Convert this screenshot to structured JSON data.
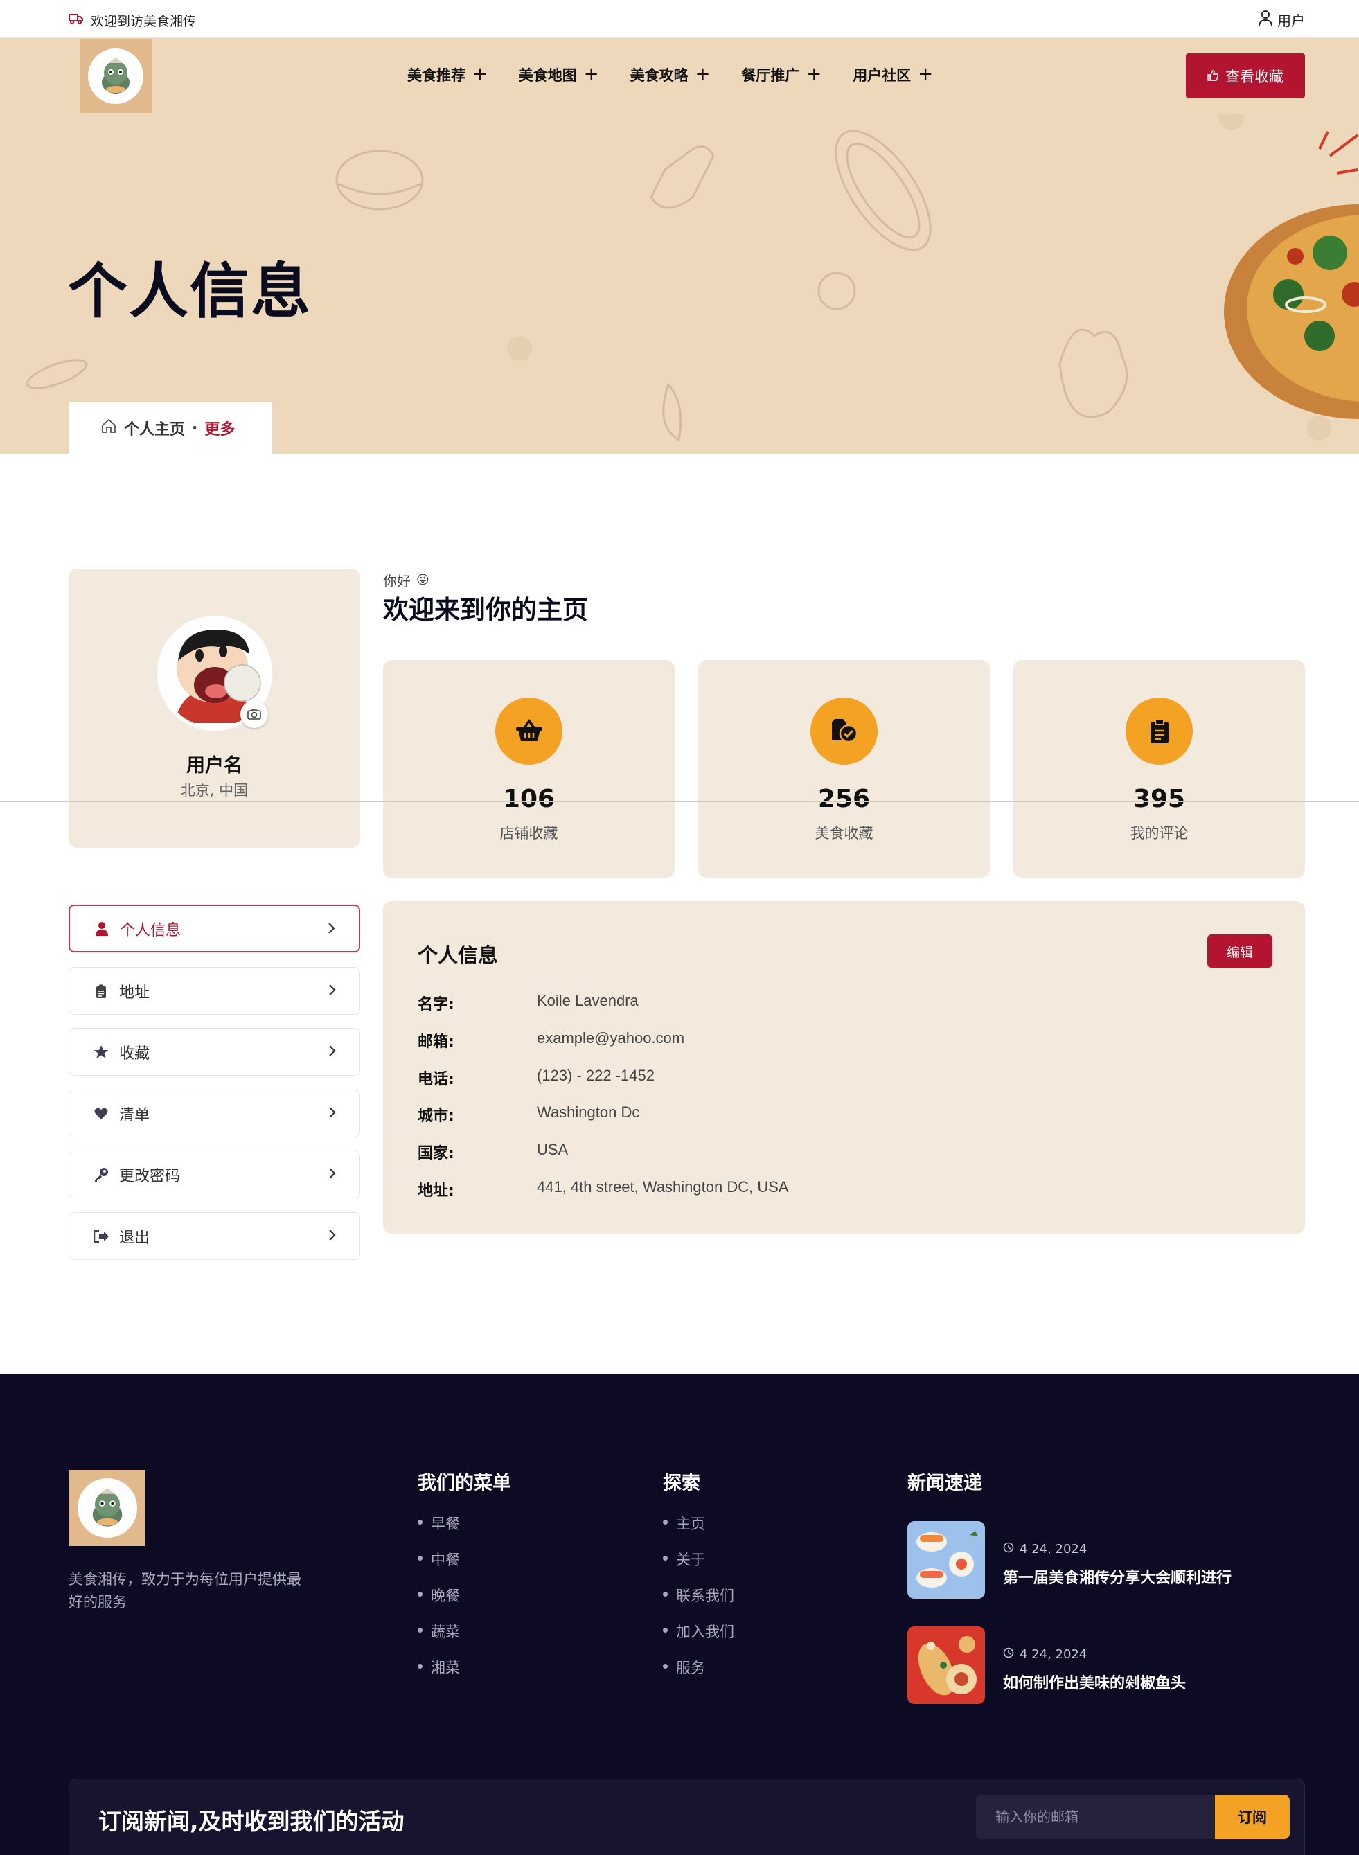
{
  "topbar": {
    "welcome": "欢迎到访美食湘传",
    "user_label": "用户"
  },
  "header": {
    "nav": [
      {
        "label": "美食推荐"
      },
      {
        "label": "美食地图"
      },
      {
        "label": "美食攻略"
      },
      {
        "label": "餐厅推广"
      },
      {
        "label": "用户社区"
      }
    ],
    "fav_button": "查看收藏"
  },
  "hero": {
    "title": "个人信息",
    "breadcrumb": {
      "home": "个人主页",
      "separator": "·",
      "current": "更多"
    }
  },
  "profile": {
    "name": "用户名",
    "location": "北京, 中国"
  },
  "greeting": {
    "small": "你好",
    "emoji": "😜",
    "title": "欢迎来到你的主页"
  },
  "stats": [
    {
      "value": "106",
      "label": "店铺收藏",
      "icon": "basket-icon"
    },
    {
      "value": "256",
      "label": "美食收藏",
      "icon": "box-check-icon"
    },
    {
      "value": "395",
      "label": "我的评论",
      "icon": "clipboard-icon"
    }
  ],
  "menu": [
    {
      "label": "个人信息",
      "icon": "user-icon",
      "active": true
    },
    {
      "label": "地址",
      "icon": "clipboard-icon"
    },
    {
      "label": "收藏",
      "icon": "star-icon"
    },
    {
      "label": "清单",
      "icon": "heart-icon"
    },
    {
      "label": "更改密码",
      "icon": "key-icon"
    },
    {
      "label": "退出",
      "icon": "logout-icon"
    }
  ],
  "info": {
    "title": "个人信息",
    "edit": "编辑",
    "rows": [
      {
        "k": "名字:",
        "v": "Koile Lavendra"
      },
      {
        "k": "邮箱:",
        "v": "example@yahoo.com"
      },
      {
        "k": "电话:",
        "v": "(123) - 222 -1452"
      },
      {
        "k": "城市:",
        "v": "Washington Dc"
      },
      {
        "k": "国家:",
        "v": "USA"
      },
      {
        "k": "地址:",
        "v": "441, 4th street, Washington DC, USA"
      }
    ]
  },
  "footer": {
    "desc": "美食湘传，致力于为每位用户提供最好的服务",
    "menu_title": "我们的菜单",
    "menu_items": [
      "早餐",
      "中餐",
      "晚餐",
      "蔬菜",
      "湘菜"
    ],
    "explore_title": "探索",
    "explore_items": [
      "主页",
      "关于",
      "联系我们",
      "加入我们",
      "服务"
    ],
    "news_title": "新闻速递",
    "news": [
      {
        "date": "4 24, 2024",
        "title": "第一届美食湘传分享大会顺利进行"
      },
      {
        "date": "4 24, 2024",
        "title": "如何制作出美味的剁椒鱼头"
      }
    ],
    "subscribe_title": "订阅新闻,及时收到我们的活动",
    "subscribe_placeholder": "输入你的邮箱",
    "subscribe_button": "订阅"
  },
  "colors": {
    "accent": "#b31530",
    "orange": "#f3a224",
    "beige": "#eed8bb",
    "card": "#f3e9dc",
    "footer": "#0d0a24"
  }
}
